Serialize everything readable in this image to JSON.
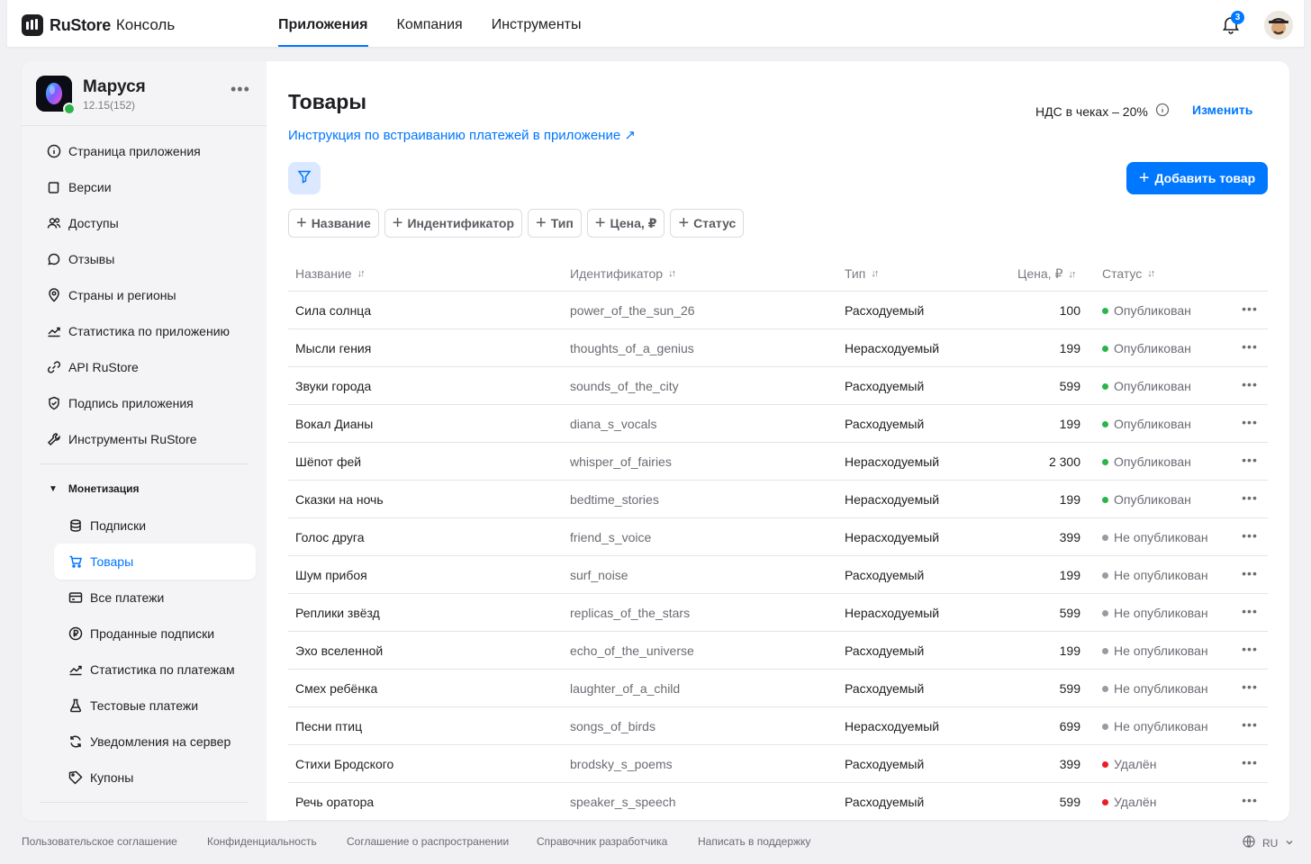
{
  "header": {
    "logo_name": "RuStore",
    "logo_sub": "Консоль",
    "nav": [
      {
        "label": "Приложения",
        "active": true
      },
      {
        "label": "Компания",
        "active": false
      },
      {
        "label": "Инструменты",
        "active": false
      }
    ],
    "notifications_count": "3"
  },
  "app": {
    "name": "Маруся",
    "version": "12.15(152)",
    "more_label": "•••"
  },
  "sidebar": {
    "items": [
      {
        "label": "Страница приложения",
        "icon": "info-icon"
      },
      {
        "label": "Версии",
        "icon": "versions-icon"
      },
      {
        "label": "Доступы",
        "icon": "users-icon"
      },
      {
        "label": "Отзывы",
        "icon": "comment-icon"
      },
      {
        "label": "Страны и регионы",
        "icon": "location-icon"
      },
      {
        "label": "Статистика по приложению",
        "icon": "chart-icon"
      },
      {
        "label": "API RuStore",
        "icon": "api-icon"
      },
      {
        "label": "Подпись приложения",
        "icon": "shield-icon"
      },
      {
        "label": "Инструменты RuStore",
        "icon": "wrench-icon"
      }
    ],
    "monetization_title": "Монетизация",
    "monetization_items": [
      {
        "label": "Подписки",
        "icon": "subscriptions-icon",
        "active": false
      },
      {
        "label": "Товары",
        "icon": "cart-icon",
        "active": true
      },
      {
        "label": "Все платежи",
        "icon": "card-icon",
        "active": false
      },
      {
        "label": "Проданные подписки",
        "icon": "coin-icon",
        "active": false
      },
      {
        "label": "Статистика по платежам",
        "icon": "chart-icon",
        "active": false
      },
      {
        "label": "Тестовые платежи",
        "icon": "flask-icon",
        "active": false
      },
      {
        "label": "Уведомления на сервер",
        "icon": "sync-bell-icon",
        "active": false
      },
      {
        "label": "Купоны",
        "icon": "coupon-icon",
        "active": false
      }
    ]
  },
  "main": {
    "title": "Товары",
    "guide_link": "Инструкция по встраиванию платежей в приложение ↗",
    "vat_text": "НДС в чеках – 20%",
    "vat_change": "Изменить",
    "add_button": "Добавить товар",
    "filter_chips": [
      "Название",
      "Индентификатор",
      "Тип",
      "Цена, ₽",
      "Статус"
    ],
    "columns": [
      "Название",
      "Идентификатор",
      "Тип",
      "Цена, ₽",
      "Статус"
    ],
    "status_colors": {
      "published": "#2bb44a",
      "unpublished": "#9a9aa2",
      "deleted": "#ed1c24"
    },
    "rows": [
      {
        "name": "Сила солнца",
        "id": "power_of_the_sun_26",
        "type": "Расходуемый",
        "price": "100",
        "status": "Опубликован",
        "state": "published"
      },
      {
        "name": "Мысли гения",
        "id": "thoughts_of_a_genius",
        "type": "Нерасходуемый",
        "price": "199",
        "status": "Опубликован",
        "state": "published"
      },
      {
        "name": "Звуки города",
        "id": "sounds_of_the_city",
        "type": "Расходуемый",
        "price": "599",
        "status": "Опубликован",
        "state": "published"
      },
      {
        "name": "Вокал Дианы",
        "id": "diana_s_vocals",
        "type": "Расходуемый",
        "price": "199",
        "status": "Опубликован",
        "state": "published"
      },
      {
        "name": "Шёпот фей",
        "id": "whisper_of_fairies",
        "type": "Нерасходуемый",
        "price": "2 300",
        "status": "Опубликован",
        "state": "published"
      },
      {
        "name": "Сказки на ночь",
        "id": "bedtime_stories",
        "type": "Нерасходуемый",
        "price": "199",
        "status": "Опубликован",
        "state": "published"
      },
      {
        "name": "Голос друга",
        "id": "friend_s_voice",
        "type": "Нерасходуемый",
        "price": "399",
        "status": "Не опубликован",
        "state": "unpublished"
      },
      {
        "name": "Шум прибоя",
        "id": "surf_noise",
        "type": "Расходуемый",
        "price": "199",
        "status": "Не опубликован",
        "state": "unpublished"
      },
      {
        "name": "Реплики звёзд",
        "id": "replicas_of_the_stars",
        "type": "Нерасходуемый",
        "price": "599",
        "status": "Не опубликован",
        "state": "unpublished"
      },
      {
        "name": "Эхо вселенной",
        "id": "echo_of_the_universe",
        "type": "Расходуемый",
        "price": "199",
        "status": "Не опубликован",
        "state": "unpublished"
      },
      {
        "name": "Смех ребёнка",
        "id": "laughter_of_a_child",
        "type": "Расходуемый",
        "price": "599",
        "status": "Не опубликован",
        "state": "unpublished"
      },
      {
        "name": "Песни птиц",
        "id": "songs_of_birds",
        "type": "Нерасходуемый",
        "price": "699",
        "status": "Не опубликован",
        "state": "unpublished"
      },
      {
        "name": "Стихи Бродского",
        "id": "brodsky_s_poems",
        "type": "Расходуемый",
        "price": "399",
        "status": "Удалён",
        "state": "deleted"
      },
      {
        "name": "Речь оратора",
        "id": "speaker_s_speech",
        "type": "Расходуемый",
        "price": "599",
        "status": "Удалён",
        "state": "deleted"
      }
    ]
  },
  "footer": {
    "links": [
      "Пользовательское соглашение",
      "Конфиденциальность",
      "Соглашение о распространении",
      "Справочник разработчика",
      "Написать в поддержку"
    ],
    "language": "RU"
  }
}
